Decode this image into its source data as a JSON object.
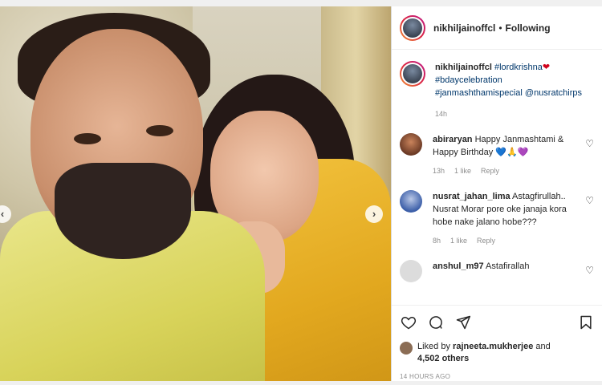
{
  "post": {
    "username": "nikhiljainoffcl",
    "follow_status": "Following",
    "dot": "•",
    "caption_user": "nikhiljainoffcl",
    "caption_tags": [
      "#lordkrishna",
      "#bdaycelebration",
      "#janmashthamispecial",
      "@nusratchirps"
    ],
    "caption_emoji": "❤",
    "caption_time": "14h"
  },
  "comments": [
    {
      "user": "abiraryan",
      "text": "Happy Janmashtami & Happy Birthday 💙🙏💜",
      "time": "13h",
      "likes": "1 like",
      "reply": "Reply"
    },
    {
      "user": "nusrat_jahan_lima",
      "text": "Astagfirullah.. Nusrat Morar pore oke janaja kora hobe nake jalano hobe???",
      "time": "8h",
      "likes": "1 like",
      "reply": "Reply"
    },
    {
      "user": "anshul_m97",
      "text": "Astafirallah",
      "time": "",
      "likes": "",
      "reply": ""
    }
  ],
  "likes": {
    "prefix": "Liked by",
    "user": "rajneeta.mukherjee",
    "and": "and",
    "others": "4,502 others"
  },
  "timestamp": "14 HOURS AGO",
  "carousel": {
    "prev": "‹",
    "next": "›"
  },
  "colors": {
    "link": "#00376b",
    "muted": "#8e8e8e",
    "text": "#262626"
  }
}
